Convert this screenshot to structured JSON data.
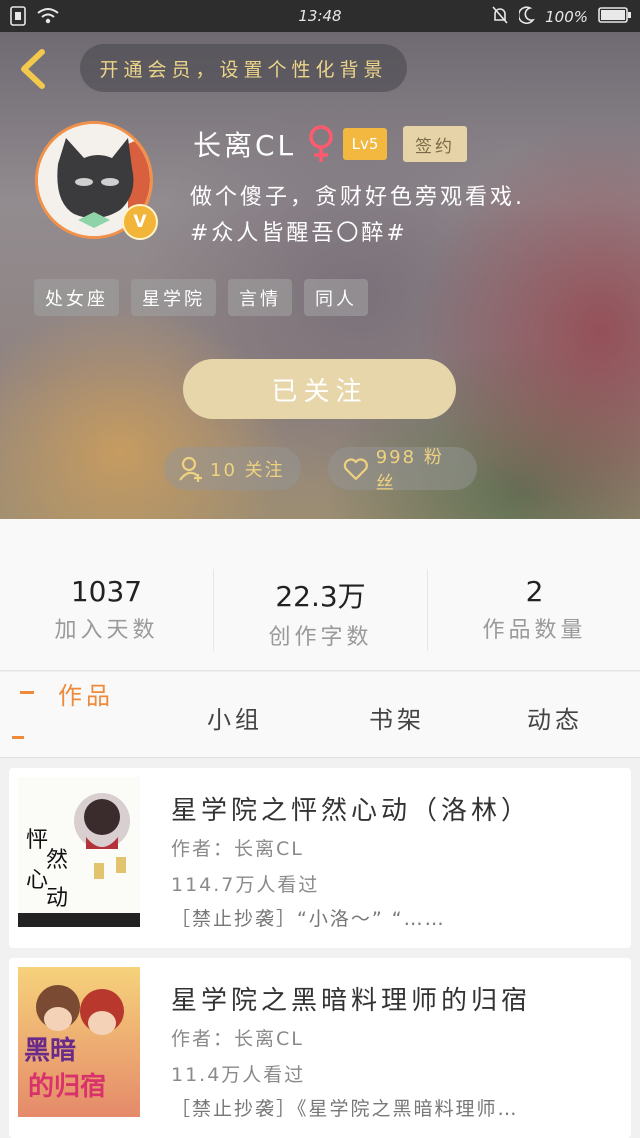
{
  "status_bar": {
    "time": "13:48",
    "battery": "100%"
  },
  "header": {
    "vip_banner": "开通会员，设置个性化背景",
    "username": "长离CL",
    "gender": "♀",
    "level": "Lv5",
    "signed": "签约",
    "vip_badge": "V",
    "bio_line1": "做个傻子，贪财好色旁观看戏.",
    "bio_line2": "#众人皆醒吾〇醉#",
    "tags": [
      "处女座",
      "星学院",
      "言情",
      "同人"
    ],
    "follow_button": "已关注",
    "following": "10 关注",
    "fans": "998 粉丝"
  },
  "stats": [
    {
      "value": "1037",
      "label": "加入天数"
    },
    {
      "value": "22.3万",
      "label": "创作字数"
    },
    {
      "value": "2",
      "label": "作品数量"
    }
  ],
  "tabs": [
    "作品",
    "小组",
    "书架",
    "动态"
  ],
  "works": [
    {
      "title": "星学院之怦然心动（洛林）",
      "author": "作者：长离CL",
      "views": "114.7万人看过",
      "desc": "［禁止抄袭］“小洛～” “……"
    },
    {
      "title": "星学院之黑暗料理师的归宿",
      "author": "作者：长离CL",
      "views": "11.4万人看过",
      "desc": "［禁止抄袭］《星学院之黑暗料理师…"
    }
  ],
  "colors": {
    "accent": "#ef8a3a",
    "gold": "#efd27f",
    "follow_button": "#e6d6a9"
  }
}
